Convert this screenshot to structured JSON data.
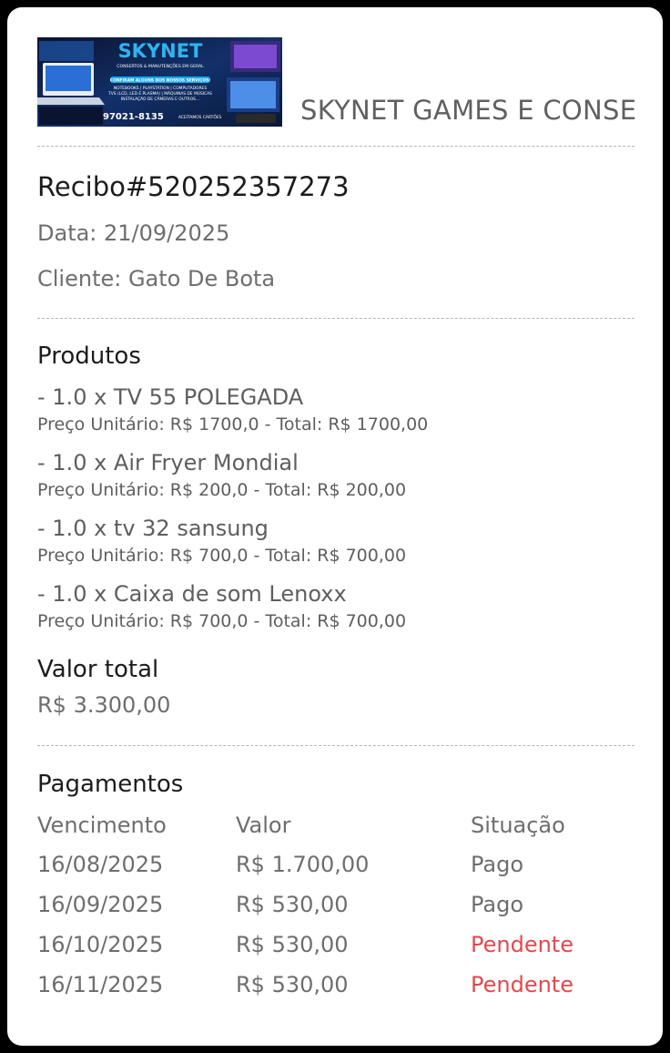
{
  "header": {
    "logo": {
      "brand": "SKYNET",
      "subtitle": "CONSERTOS & MANUTENÇÕES EM GERAL",
      "services_title": "CONFIRAM ALGUNS DOS NOSSOS SERVIÇOS:",
      "services_line1": "NOTEBOOKS | PLAYSTATION | COMPUTADORES",
      "services_line2": "TVS (LCD, LED E PLASMA) | MÁQUINAS DE MÚSICAS",
      "services_line3": "INSTALAÇÃO DE CÂMERAS E OUTROS...",
      "phone": "97021-8135",
      "payment_note": "ACEITAMOS CARTÕES",
      "colors": {
        "background": "#0c1a3a",
        "accent": "#1aa9e8",
        "text": "#ffffff"
      }
    },
    "company_name": "SKYNET GAMES E CONSE"
  },
  "receipt": {
    "number": "Recibo#520252357273",
    "date": "Data: 21/09/2025",
    "client": "Cliente: Gato De Bota"
  },
  "products": {
    "title": "Produtos",
    "items": [
      {
        "name": "- 1.0 x TV 55 POLEGADA",
        "price": "Preço Unitário: R$ 1700,0 - Total: R$ 1700,00"
      },
      {
        "name": "- 1.0 x Air Fryer Mondial",
        "price": "Preço Unitário: R$ 200,0 - Total: R$ 200,00"
      },
      {
        "name": "- 1.0 x tv 32 sansung",
        "price": "Preço Unitário: R$ 700,0 - Total: R$ 700,00"
      },
      {
        "name": "- 1.0 x Caixa de som Lenoxx",
        "price": "Preço Unitário: R$ 700,0 - Total: R$ 700,00"
      }
    ]
  },
  "total": {
    "title": "Valor total",
    "value": "R$ 3.300,00"
  },
  "payments": {
    "title": "Pagamentos",
    "columns": [
      "Vencimento",
      "Valor",
      "Situação"
    ],
    "rows": [
      {
        "due": "16/08/2025",
        "value": "R$ 1.700,00",
        "status": "Pago",
        "status_color": "#6e6e6e"
      },
      {
        "due": "16/09/2025",
        "value": "R$ 530,00",
        "status": "Pago",
        "status_color": "#6e6e6e"
      },
      {
        "due": "16/10/2025",
        "value": "R$ 530,00",
        "status": "Pendente",
        "status_color": "#e5484d"
      },
      {
        "due": "16/11/2025",
        "value": "R$ 530,00",
        "status": "Pendente",
        "status_color": "#e5484d"
      }
    ]
  }
}
